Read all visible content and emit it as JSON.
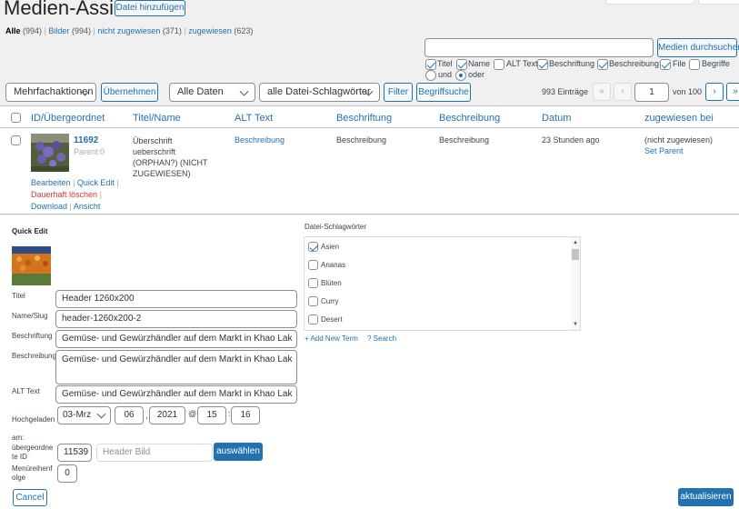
{
  "page": {
    "title": "Medien-Assistent",
    "add_file_button": "Datei hinzufügen"
  },
  "filters": {
    "all_label": "Alle",
    "all_count": "(994)",
    "images_label": "Bilder",
    "images_count": "(994)",
    "unattached_label": "nicht zugewiesen",
    "unattached_count": "(371)",
    "attached_label": "zugewiesen",
    "attached_count": "(623)",
    "separator": "|"
  },
  "search": {
    "button": "Medien durchsuchen",
    "options": {
      "titel": "Titel",
      "name": "Name",
      "alt": "ALT Text",
      "caption": "Beschriftung",
      "description": "Beschreibung",
      "file": "File",
      "terms": "Begriffe"
    },
    "and_label": "und",
    "or_label": "oder"
  },
  "toolbar": {
    "bulk_action": "Mehrfachaktionen",
    "apply_button": "Übernehmen",
    "all_dates": "Alle Daten",
    "all_tags": "alle Datei-Schlagwörter",
    "filter_button": "Filter",
    "terms_search_button": "Begriffsuche",
    "items_count": "993 Einträge",
    "first_page": "«",
    "prev_page": "‹",
    "current_page": "1",
    "of_pages": "von 100",
    "next_page": "›",
    "last_page": "»"
  },
  "table": {
    "headers": {
      "id": "ID/Übergeordnet",
      "title": "Titel/Name",
      "alt": "ALT Text",
      "caption": "Beschriftung",
      "description": "Beschreibung",
      "date": "Datum",
      "attached": "zugewiesen bei"
    },
    "row": {
      "id": "11692",
      "parent": "Parent:0",
      "title": "Überschrift ueberschrift (ORPHAN?) (NICHT ZUGEWIESEN)",
      "title_lines": [
        "Überschrift",
        "ueberschrift",
        "(ORPHAN?) (NICHT",
        "ZUGEWIESEN)"
      ],
      "alt": "Beschreibung",
      "caption": "Beschreibung",
      "description": "Beschreibung",
      "date": "23 Stunden ago",
      "attached_status": "(nicht zugewiesen)",
      "set_parent": "Set Parent",
      "actions": {
        "edit": "Bearbeiten",
        "quick_edit": "Quick Edit",
        "delete": "Dauerhaft löschen",
        "download": "Download",
        "view": "Ansicht"
      }
    }
  },
  "quick_edit": {
    "heading": "Quick Edit",
    "fields": {
      "title_label": "Titel",
      "title_value": "Header 1260x200",
      "slug_label": "Name/Slug",
      "slug_value": "header-1260x200-2",
      "caption_label": "Beschriftung",
      "caption_value": "Gemüse- und Gewürzhändler auf dem Markt in Khao Lak",
      "description_label": "Beschreibung",
      "description_value": "Gemüse- und Gewürzhändler auf dem Markt in Khao Lak",
      "alt_label": "ALT Text",
      "alt_value": "Gemüse- und Gewürzhändler auf dem Markt in Khao Lak",
      "uploaded_label": "Hochgeladen am:",
      "uploaded_label_line1": "Hochgeladen",
      "uploaded_label_line2": "am:",
      "day_month": "03-Mrz",
      "day": "06",
      "year": "2021",
      "at": "@",
      "hour": "15",
      "minute": "16",
      "parent_label": "übergeordnete ID",
      "parent_label_line1": "übergeordne",
      "parent_label_line2": "te ID",
      "parent_id": "11539",
      "parent_title_placeholder": "Header Bild",
      "select_button": "auswählen",
      "menu_order_label": "Menüreihenfolge",
      "menu_order_line1": "Menüreihenf",
      "menu_order_line2": "olge",
      "menu_order_value": "0"
    },
    "tags": {
      "heading": "Datei-Schlagwörter",
      "items": [
        "Asien",
        "Ananas",
        "Blüten",
        "Curry",
        "Desert"
      ],
      "add_new": "+ Add New Term",
      "search": "? Search"
    },
    "cancel_button": "Cancel",
    "update_button": "aktualisieren"
  },
  "colors": {
    "accent": "#2271b1",
    "danger": "#d63638",
    "background": "#f0f0f1",
    "panel": "#ffffff"
  }
}
